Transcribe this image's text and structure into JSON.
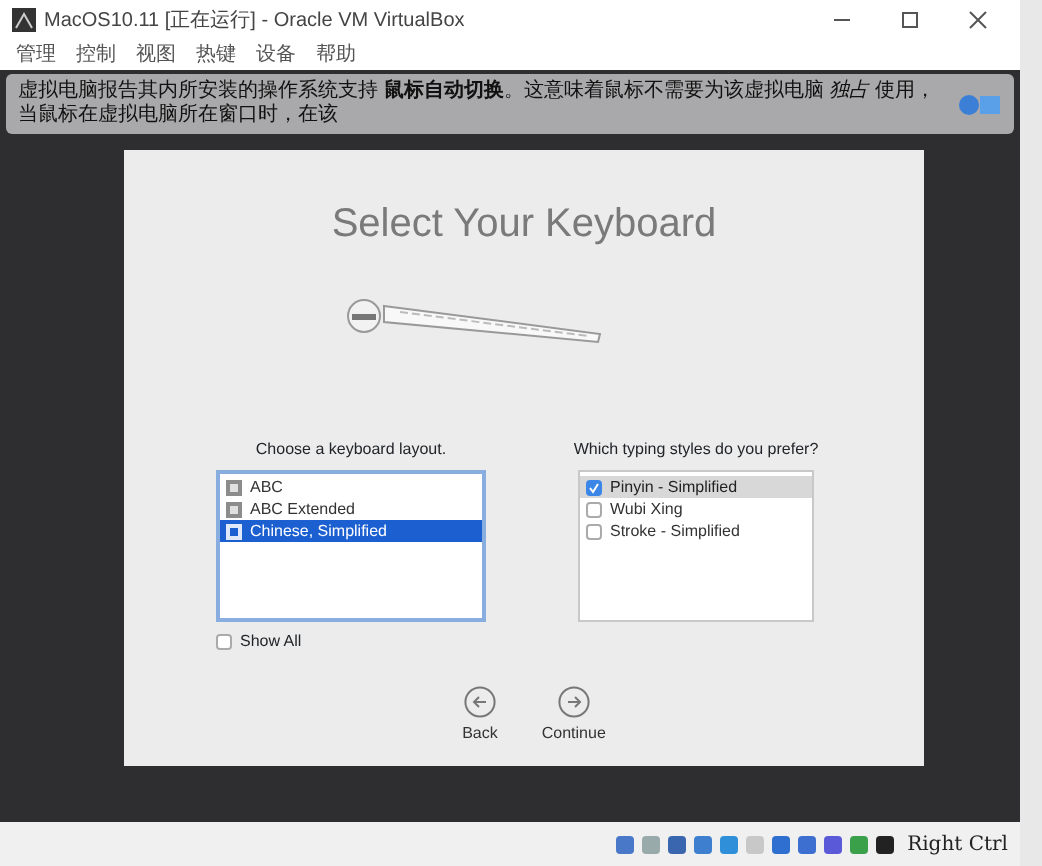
{
  "window": {
    "title": "MacOS10.11 [正在运行] - Oracle VM VirtualBox"
  },
  "menu": [
    "管理",
    "控制",
    "视图",
    "热键",
    "设备",
    "帮助"
  ],
  "notification": {
    "text": "虚拟电脑报告其内所安装的操作系统支持 **鼠标自动切换**。这意味着鼠标不需要为该虚拟电脑 *独占* 使用，当鼠标在虚拟电脑所在窗口时，在该"
  },
  "setup": {
    "title": "Select Your Keyboard",
    "layout_label": "Choose a keyboard layout.",
    "layouts": [
      {
        "label": "ABC",
        "selected": false
      },
      {
        "label": "ABC Extended",
        "selected": false
      },
      {
        "label": "Chinese, Simplified",
        "selected": true
      }
    ],
    "show_all": {
      "label": "Show All",
      "checked": false
    },
    "styles_label": "Which typing styles do you prefer?",
    "styles": [
      {
        "label": "Pinyin - Simplified",
        "checked": true,
        "selected": true
      },
      {
        "label": "Wubi Xing",
        "checked": false,
        "selected": false
      },
      {
        "label": "Stroke - Simplified",
        "checked": false,
        "selected": false
      }
    ],
    "buttons": [
      {
        "kind": "back",
        "label": "Back"
      },
      {
        "kind": "continue",
        "label": "Continue"
      }
    ]
  },
  "status_bar": {
    "host_key": "Right Ctrl"
  }
}
